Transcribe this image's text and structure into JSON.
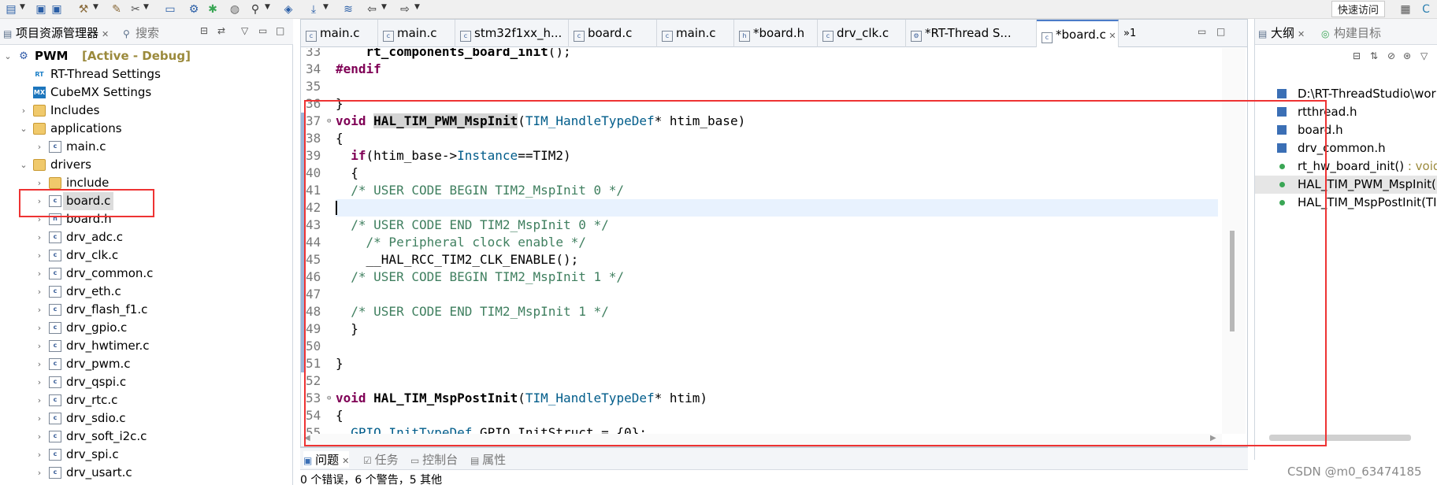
{
  "toolbar": {
    "quick_access": "快速访问"
  },
  "explorer": {
    "tabs": [
      {
        "label": "项目资源管理器"
      },
      {
        "label": "搜索"
      }
    ],
    "project_name": "PWM",
    "project_status": "[Active - Debug]",
    "items": [
      {
        "label": "RT-Thread Settings",
        "icon": "rt-settings-icon"
      },
      {
        "label": "CubeMX Settings",
        "icon": "cubemx-icon"
      },
      {
        "label": "Includes",
        "icon": "includes-icon"
      },
      {
        "label": "applications",
        "icon": "folder-icon"
      },
      {
        "label": "main.c",
        "icon": "c-file-icon"
      },
      {
        "label": "drivers",
        "icon": "folder-icon"
      },
      {
        "label": "include",
        "icon": "folder-icon"
      },
      {
        "label": "board.c",
        "icon": "c-file-icon"
      },
      {
        "label": "board.h",
        "icon": "h-file-icon"
      },
      {
        "label": "drv_adc.c",
        "icon": "c-file-icon"
      },
      {
        "label": "drv_clk.c",
        "icon": "c-file-icon"
      },
      {
        "label": "drv_common.c",
        "icon": "c-file-icon"
      },
      {
        "label": "drv_eth.c",
        "icon": "c-file-icon"
      },
      {
        "label": "drv_flash_f1.c",
        "icon": "c-file-icon"
      },
      {
        "label": "drv_gpio.c",
        "icon": "c-file-icon"
      },
      {
        "label": "drv_hwtimer.c",
        "icon": "c-file-icon"
      },
      {
        "label": "drv_pwm.c",
        "icon": "c-file-icon"
      },
      {
        "label": "drv_qspi.c",
        "icon": "c-file-icon"
      },
      {
        "label": "drv_rtc.c",
        "icon": "c-file-icon"
      },
      {
        "label": "drv_sdio.c",
        "icon": "c-file-icon"
      },
      {
        "label": "drv_soft_i2c.c",
        "icon": "c-file-icon"
      },
      {
        "label": "drv_spi.c",
        "icon": "c-file-icon"
      },
      {
        "label": "drv_usart.c",
        "icon": "c-file-icon"
      }
    ]
  },
  "editor": {
    "tabs": [
      {
        "label": "main.c"
      },
      {
        "label": "main.c"
      },
      {
        "label": "stm32f1xx_h..."
      },
      {
        "label": "board.c"
      },
      {
        "label": "main.c"
      },
      {
        "label": "*board.h"
      },
      {
        "label": "drv_clk.c"
      },
      {
        "label": "*RT-Thread S..."
      },
      {
        "label": "*board.c"
      }
    ],
    "overflow_count": "»1",
    "lines": [
      {
        "num": "33",
        "text": "    rt_components_board_init();"
      },
      {
        "num": "34",
        "text": "#endif"
      },
      {
        "num": "35",
        "text": ""
      },
      {
        "num": "36",
        "text": "}"
      },
      {
        "num": "37",
        "text": "void HAL_TIM_PWM_MspInit(TIM_HandleTypeDef* htim_base)"
      },
      {
        "num": "38",
        "text": "{"
      },
      {
        "num": "39",
        "text": "  if(htim_base->Instance==TIM2)"
      },
      {
        "num": "40",
        "text": "  {"
      },
      {
        "num": "41",
        "text": "  /* USER CODE BEGIN TIM2_MspInit 0 */"
      },
      {
        "num": "42",
        "text": ""
      },
      {
        "num": "43",
        "text": "  /* USER CODE END TIM2_MspInit 0 */"
      },
      {
        "num": "44",
        "text": "    /* Peripheral clock enable */"
      },
      {
        "num": "45",
        "text": "    __HAL_RCC_TIM2_CLK_ENABLE();"
      },
      {
        "num": "46",
        "text": "  /* USER CODE BEGIN TIM2_MspInit 1 */"
      },
      {
        "num": "47",
        "text": ""
      },
      {
        "num": "48",
        "text": "  /* USER CODE END TIM2_MspInit 1 */"
      },
      {
        "num": "49",
        "text": "  }"
      },
      {
        "num": "50",
        "text": ""
      },
      {
        "num": "51",
        "text": "}"
      },
      {
        "num": "52",
        "text": ""
      },
      {
        "num": "53",
        "text": "void HAL_TIM_MspPostInit(TIM_HandleTypeDef* htim)"
      },
      {
        "num": "54",
        "text": "{"
      },
      {
        "num": "55",
        "text": "  GPIO_InitTypeDef GPIO_InitStruct = {0};"
      }
    ]
  },
  "outline": {
    "tabs": [
      {
        "label": "大纲"
      },
      {
        "label": "构建目标"
      }
    ],
    "items": [
      {
        "label": "D:\\RT-ThreadStudio\\wor",
        "type": "",
        "icon": "include-icon"
      },
      {
        "label": "rtthread.h",
        "type": "",
        "icon": "include-icon"
      },
      {
        "label": "board.h",
        "type": "",
        "icon": "include-icon"
      },
      {
        "label": "drv_common.h",
        "type": "",
        "icon": "include-icon"
      },
      {
        "label": "rt_hw_board_init()",
        "type": " : void",
        "icon": "function-icon"
      },
      {
        "label": "HAL_TIM_PWM_MspInit(",
        "type": "",
        "icon": "function-icon"
      },
      {
        "label": "HAL_TIM_MspPostInit(TI",
        "type": "",
        "icon": "function-icon"
      }
    ]
  },
  "bottom": {
    "tabs": [
      {
        "label": "问题"
      },
      {
        "label": "任务"
      },
      {
        "label": "控制台"
      },
      {
        "label": "属性"
      }
    ],
    "status": "0 个错误，6 个警告，5 其他"
  },
  "watermark": "CSDN @m0_63474185",
  "colors": {
    "annotation": "#e33333",
    "keyword": "#7f0055",
    "comment": "#3f7f5f"
  }
}
